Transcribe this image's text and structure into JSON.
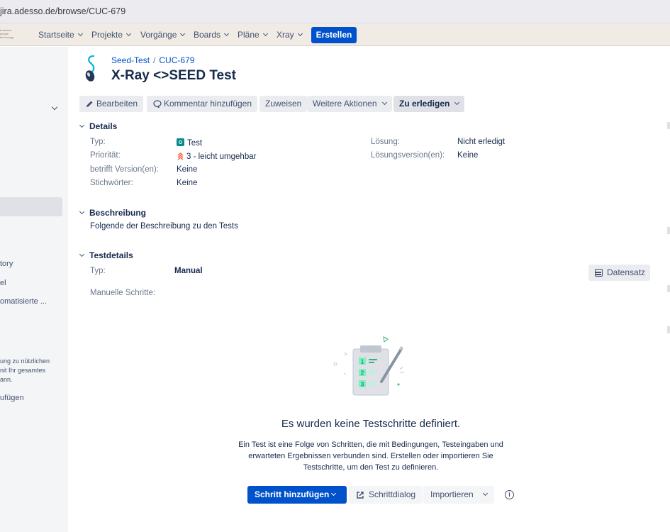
{
  "browser": {
    "url": "jira.adesso.de/browse/CUC-679"
  },
  "topnav": {
    "logo_text": "business. people. technology.",
    "items": [
      "Startseite",
      "Projekte",
      "Vorgänge",
      "Boards",
      "Pläne",
      "Xray"
    ],
    "create_label": "Erstellen"
  },
  "sidebar": {
    "items": [
      "tory",
      "el",
      "omatisierte ...",
      "ufügen"
    ],
    "note_lines": [
      "ung zu nützlichen",
      "nit Ihr gesamtes",
      "ann."
    ]
  },
  "issue": {
    "breadcrumb_project": "Seed-Test",
    "breadcrumb_separator": "/",
    "breadcrumb_key": "CUC-679",
    "title": "X-Ray <>SEED Test"
  },
  "toolbar": {
    "edit": "Bearbeiten",
    "comment": "Kommentar hinzufügen",
    "assign": "Zuweisen",
    "more": "Weitere Aktionen",
    "todo": "Zu erledigen"
  },
  "details": {
    "heading": "Details",
    "type_label": "Typ:",
    "type_value": "Test",
    "priority_label": "Priorität:",
    "priority_value": "3 - leicht umgehbar",
    "affects_label": "betrifft Version(en):",
    "affects_value": "Keine",
    "labels_label": "Stichwörter:",
    "labels_value": "Keine",
    "resolution_label": "Lösung:",
    "resolution_value": "Nicht erledigt",
    "fixversion_label": "Lösungsversion(en):",
    "fixversion_value": "Keine"
  },
  "description": {
    "heading": "Beschreibung",
    "text": "Folgende der Beschreibung zu den Tests"
  },
  "testdetails": {
    "heading": "Testdetails",
    "type_label": "Typ:",
    "type_value": "Manual",
    "dataset_button": "Datensatz",
    "steps_label": "Manuelle Schritte:"
  },
  "empty_state": {
    "title": "Es wurden keine Testschritte definiert.",
    "text": "Ein Test ist eine Folge von Schritten, die mit Bedingungen, Testeingaben und erwarteten Ergebnissen verbunden sind. Erstellen oder importieren Sie Testschritte, um den Test zu definieren.",
    "add_step": "Schritt hinzufügen",
    "step_dialog": "Schrittdialog",
    "import": "Importieren",
    "step_numbers": [
      "1",
      "2",
      "3"
    ]
  },
  "colors": {
    "primary": "#0052cc",
    "text": "#172b4d",
    "muted": "#6b778c",
    "nav_bg": "#f0ebe4",
    "sidebar_bg": "#f4f5f7",
    "button_bg": "#ebecf0",
    "test_type": "#0b8a8a",
    "priority": "#ff5630",
    "illustration_green": "#36b37e"
  }
}
